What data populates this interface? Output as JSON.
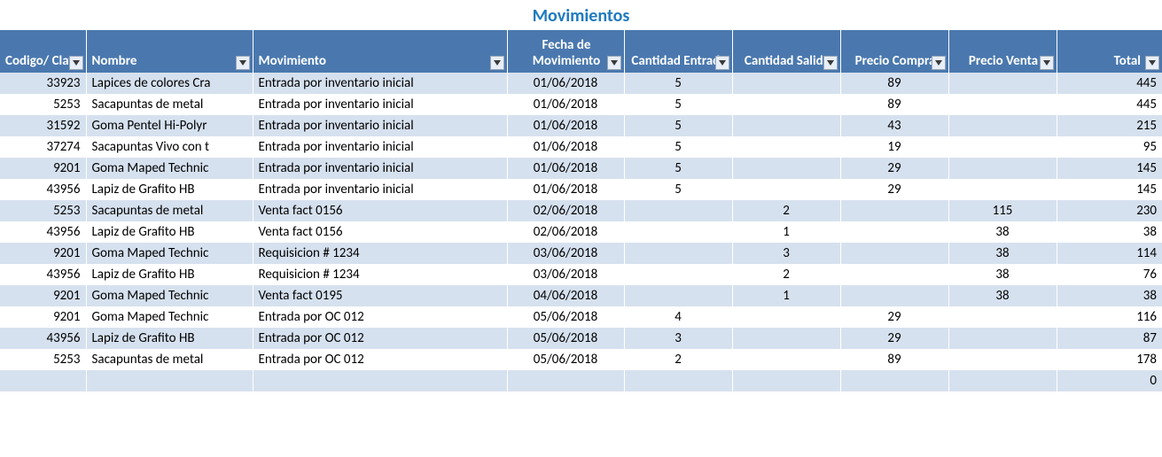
{
  "title": "Movimientos",
  "headers": {
    "codigo": "Codigo/ Clave",
    "nombre": "Nombre",
    "movimiento": "Movimiento",
    "fecha": "Fecha de Movimiento",
    "entrada": "Cantidad Entrada",
    "salida": "Cantidad Salida",
    "precio_compra": "Precio Compra",
    "precio_venta": "Precio Venta",
    "total": "Total"
  },
  "rows": [
    {
      "codigo": "33923",
      "nombre": "Lapices de colores Cra",
      "mov": "Entrada por inventario inicial",
      "fecha": "01/06/2018",
      "ent": "5",
      "sal": "",
      "pc": "89",
      "pv": "",
      "total": "445"
    },
    {
      "codigo": "5253",
      "nombre": "Sacapuntas de metal",
      "mov": "Entrada por inventario inicial",
      "fecha": "01/06/2018",
      "ent": "5",
      "sal": "",
      "pc": "89",
      "pv": "",
      "total": "445"
    },
    {
      "codigo": "31592",
      "nombre": "Goma Pentel Hi-Polyr",
      "mov": "Entrada por inventario inicial",
      "fecha": "01/06/2018",
      "ent": "5",
      "sal": "",
      "pc": "43",
      "pv": "",
      "total": "215"
    },
    {
      "codigo": "37274",
      "nombre": "Sacapuntas Vivo con t",
      "mov": "Entrada por inventario inicial",
      "fecha": "01/06/2018",
      "ent": "5",
      "sal": "",
      "pc": "19",
      "pv": "",
      "total": "95"
    },
    {
      "codigo": "9201",
      "nombre": "Goma Maped Technic",
      "mov": "Entrada por inventario inicial",
      "fecha": "01/06/2018",
      "ent": "5",
      "sal": "",
      "pc": "29",
      "pv": "",
      "total": "145"
    },
    {
      "codigo": "43956",
      "nombre": "Lapiz de Grafito HB",
      "mov": "Entrada por inventario inicial",
      "fecha": "01/06/2018",
      "ent": "5",
      "sal": "",
      "pc": "29",
      "pv": "",
      "total": "145"
    },
    {
      "codigo": "5253",
      "nombre": "Sacapuntas de metal",
      "mov": "Venta fact 0156",
      "fecha": "02/06/2018",
      "ent": "",
      "sal": "2",
      "pc": "",
      "pv": "115",
      "total": "230"
    },
    {
      "codigo": "43956",
      "nombre": "Lapiz de Grafito HB",
      "mov": "Venta fact 0156",
      "fecha": "02/06/2018",
      "ent": "",
      "sal": "1",
      "pc": "",
      "pv": "38",
      "total": "38"
    },
    {
      "codigo": "9201",
      "nombre": "Goma Maped Technic",
      "mov": "Requisicion # 1234",
      "fecha": "03/06/2018",
      "ent": "",
      "sal": "3",
      "pc": "",
      "pv": "38",
      "total": "114"
    },
    {
      "codigo": "43956",
      "nombre": "Lapiz de Grafito HB",
      "mov": "Requisicion # 1234",
      "fecha": "03/06/2018",
      "ent": "",
      "sal": "2",
      "pc": "",
      "pv": "38",
      "total": "76"
    },
    {
      "codigo": "9201",
      "nombre": "Goma Maped Technic",
      "mov": "Venta fact 0195",
      "fecha": "04/06/2018",
      "ent": "",
      "sal": "1",
      "pc": "",
      "pv": "38",
      "total": "38"
    },
    {
      "codigo": "9201",
      "nombre": "Goma Maped Technic",
      "mov": "Entrada por OC 012",
      "fecha": "05/06/2018",
      "ent": "4",
      "sal": "",
      "pc": "29",
      "pv": "",
      "total": "116"
    },
    {
      "codigo": "43956",
      "nombre": "Lapiz de Grafito HB",
      "mov": "Entrada por OC 012",
      "fecha": "05/06/2018",
      "ent": "3",
      "sal": "",
      "pc": "29",
      "pv": "",
      "total": "87"
    },
    {
      "codigo": "5253",
      "nombre": "Sacapuntas de metal",
      "mov": "Entrada por OC 012",
      "fecha": "05/06/2018",
      "ent": "2",
      "sal": "",
      "pc": "89",
      "pv": "",
      "total": "178"
    },
    {
      "codigo": "",
      "nombre": "",
      "mov": "",
      "fecha": "",
      "ent": "",
      "sal": "",
      "pc": "",
      "pv": "",
      "total": "0"
    }
  ]
}
